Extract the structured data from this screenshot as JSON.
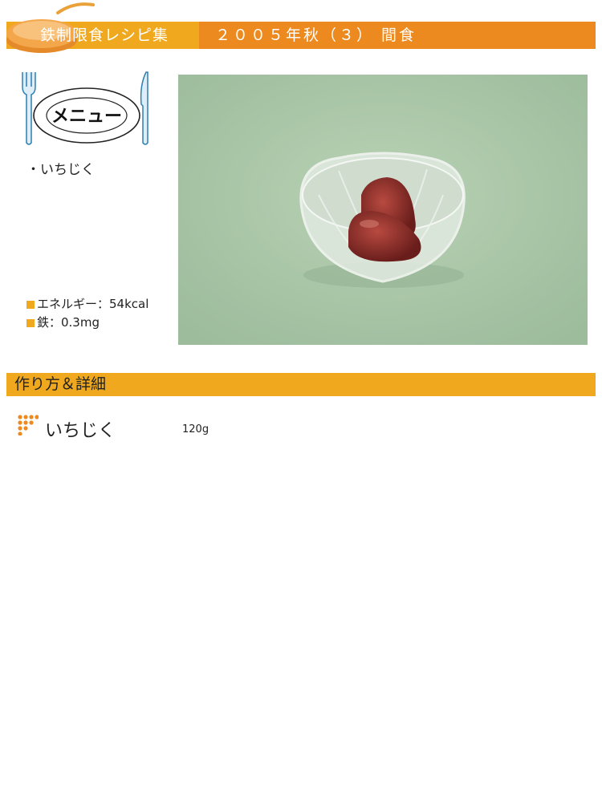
{
  "header": {
    "title": "鉄制限食レシピ集",
    "subtitle": "２００５年秋（３） 間食"
  },
  "menu": {
    "label": "メニュー",
    "items": [
      "・いちじく"
    ]
  },
  "nutrition": {
    "energy": "エネルギー：54kcal",
    "iron": "鉄：0.3mg"
  },
  "section": {
    "title": "作り方＆詳細"
  },
  "ingredients": [
    {
      "name": "いちじく",
      "amount": "120g"
    }
  ],
  "colors": {
    "header_orange": "#ec8a1f",
    "accent_yellow": "#f0a91e",
    "photo_background": "#a9c6a7",
    "fig": "#8a2a26"
  }
}
